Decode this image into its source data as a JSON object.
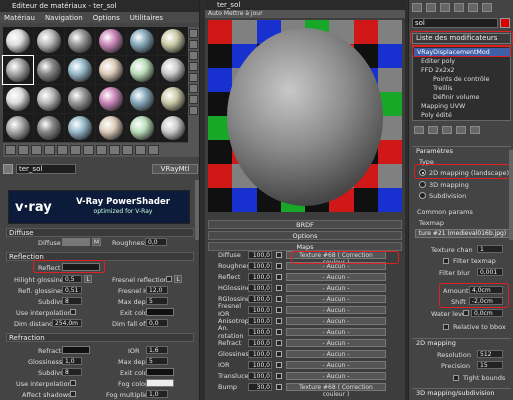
{
  "material_editor": {
    "title": "Editeur de matériaux - ter_sol",
    "menu": [
      "Matériau",
      "Navigation",
      "Options",
      "Utilitaires"
    ],
    "material_name": "ter_sol",
    "material_type": "VRayMtl",
    "vray_logo": "v·ray",
    "vray_banner_title": "V-Ray PowerShader",
    "vray_banner_sub": "optimized for V-Ray",
    "diffuse": {
      "section": "Diffuse",
      "diffuse_label": "Diffuse",
      "diffuse_map_button": "M",
      "roughness_label": "Roughness",
      "roughness_value": "0,0"
    },
    "reflection": {
      "section": "Reflection",
      "reflect_label": "Reflect",
      "hilight_gloss_label": "Hilight glossiness",
      "hilight_gloss_value": "0,5",
      "l_button": "L",
      "fresnel_refl_label": "Fresnel reflections",
      "refl_gloss_label": "Refl. glossiness",
      "refl_gloss_value": "0,51",
      "fresnel_ior_label": "Fresnel IOR",
      "fresnel_ior_value": "12,0",
      "subdivs_label": "Subdivs",
      "subdivs_value": "8",
      "max_depth_label": "Max depth",
      "max_depth_value": "5",
      "use_interp_label": "Use interpolation",
      "exit_color_label": "Exit color",
      "dim_distance_label": "Dim distance",
      "dim_distance_value": "254,0m",
      "dim_falloff_label": "Dim fall off",
      "dim_falloff_value": "0,0"
    },
    "refraction": {
      "section": "Refraction",
      "refract_label": "Refract",
      "ior_label": "IOR",
      "ior_value": "1,6",
      "glossiness_label": "Glossiness",
      "glossiness_value": "1,0",
      "max_depth_label": "Max depth",
      "max_depth_value": "5",
      "subdivs_label": "Subdivs",
      "subdivs_value": "8",
      "exit_color_label": "Exit color",
      "use_interp_label": "Use interpolation",
      "fog_color_label": "Fog color",
      "affect_shadows_label": "Affect shadows",
      "fog_multiplier_label": "Fog multiplier",
      "fog_multiplier_value": "1,0"
    }
  },
  "preview": {
    "title": "ter_sol",
    "toolbar": "Auto   Mettre à jour",
    "tab_brdf": "BRDF",
    "tab_options": "Options",
    "tab_maps": "Maps",
    "maps": [
      {
        "name": "Diffuse",
        "value": "100,0",
        "map": "Texture #68 ( Correction couleur )"
      },
      {
        "name": "Roughness",
        "value": "100,0",
        "map": "- Aucun -"
      },
      {
        "name": "Reflect",
        "value": "100,0",
        "map": "- Aucun -"
      },
      {
        "name": "HGlossiness",
        "value": "100,0",
        "map": "- Aucun -"
      },
      {
        "name": "RGlossiness",
        "value": "100,0",
        "map": "- Aucun -"
      },
      {
        "name": "Fresnel IOR",
        "value": "100,0",
        "map": "- Aucun -"
      },
      {
        "name": "Anisotropy",
        "value": "100,0",
        "map": "- Aucun -"
      },
      {
        "name": "An. rotation",
        "value": "100,0",
        "map": "- Aucun -"
      },
      {
        "name": "Refract",
        "value": "100,0",
        "map": "- Aucun -"
      },
      {
        "name": "Glossiness",
        "value": "100,0",
        "map": "- Aucun -"
      },
      {
        "name": "IOR",
        "value": "100,0",
        "map": "- Aucun -"
      },
      {
        "name": "Translucent",
        "value": "100,0",
        "map": "- Aucun -"
      },
      {
        "name": "Bump",
        "value": "30,0",
        "map": "Texture #68 ( Correction couleur )"
      }
    ]
  },
  "command_panel": {
    "object_name": "sol",
    "modifier_list": "Liste des modificateurs",
    "stack": [
      {
        "label": "VRayDisplacementMod",
        "selected": true
      },
      {
        "label": "Editer poly",
        "selected": false
      },
      {
        "label": "FFD 2x2x2",
        "selected": false
      },
      {
        "label": "Points de contrôle",
        "selected": false
      },
      {
        "label": "Treillis",
        "selected": false
      },
      {
        "label": "Définir volume",
        "selected": false
      },
      {
        "label": "Mapping UVW",
        "selected": false
      },
      {
        "label": "Poly édité",
        "selected": false
      }
    ],
    "params_header": "Paramètres",
    "type_section": "Type",
    "type_options": [
      "2D mapping (landscape)",
      "3D mapping",
      "Subdivision"
    ],
    "common_section": "Common params",
    "texmap_label": "Texmap",
    "texmap_value": "ture #21 (medieval016b.jpg)",
    "texture_chan_label": "Texture chan",
    "texture_chan_value": "1",
    "filter_texmap_label": "Filter texmap",
    "filter_blur_label": "Filter blur",
    "filter_blur_value": "0,001",
    "amount_label": "Amount",
    "amount_value": "4,0cm",
    "shift_label": "Shift",
    "shift_value": "-2,0cm",
    "water_level_label": "Water level",
    "water_level_value": "0,0cm",
    "relative_bbox_label": "Relative to bbox",
    "mapping_section": "2D mapping",
    "resolution_label": "Resolution",
    "resolution_value": "512",
    "precision_label": "Precision",
    "precision_value": "15",
    "tight_bounds_label": "Tight bounds",
    "next_section": "3D mapping/subdivision"
  },
  "colors": {
    "highlight_red": "#e02020",
    "vray_banner": "#0d1b3a",
    "checker": [
      "#d01818",
      "#18a828",
      "#1830d0",
      "#101010",
      "#808080"
    ]
  }
}
